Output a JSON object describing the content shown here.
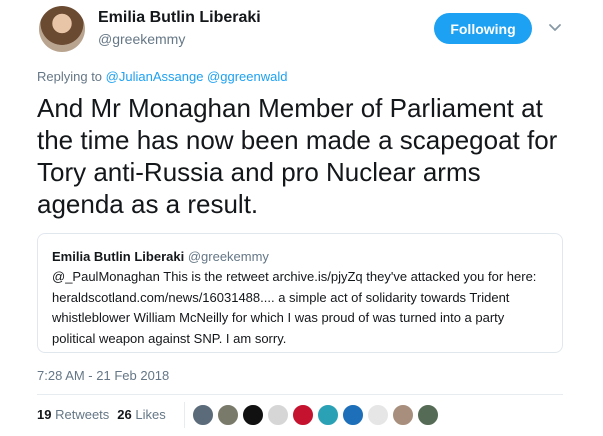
{
  "author": {
    "display_name": "Emilia Butlin Liberaki",
    "handle": "@greekemmy"
  },
  "follow_button_label": "Following",
  "reply": {
    "prefix": "Replying to",
    "mentions": "@JulianAssange @ggreenwald"
  },
  "tweet_lines": [
    "And Mr Monaghan Member of Parliament at",
    "the time has now been made a scapegoat for",
    "Tory anti-Russia and pro Nuclear arms",
    "agenda as a result."
  ],
  "quoted_tweet": {
    "display_name": "Emilia Butlin Liberaki",
    "handle": "@greekemmy",
    "lines": [
      "@_PaulMonaghan This is the retweet archive.is/pjyZq they've attacked you for here:",
      "heraldscotland.com/news/16031488.... a simple act of solidarity towards Trident",
      "whistleblower William McNeilly for which I was proud of was turned into a party",
      "political weapon against SNP. I am sorry."
    ]
  },
  "timestamp": "7:28 AM - 21 Feb 2018",
  "stats": {
    "retweets_count": "19",
    "retweets_label": "Retweets",
    "likes_count": "26",
    "likes_label": "Likes"
  },
  "liker_avatar_colors": [
    "#5b6b7a",
    "#7a7a6a",
    "#111111",
    "#d6d6d6",
    "#c4122f",
    "#2aa1b5",
    "#1c6fb8",
    "#e6e6e6",
    "#a88f7d",
    "#556b55"
  ],
  "colors": {
    "accent": "#1da1f2",
    "text": "#14171a",
    "secondary": "#657786",
    "border": "#e1e8ed"
  }
}
